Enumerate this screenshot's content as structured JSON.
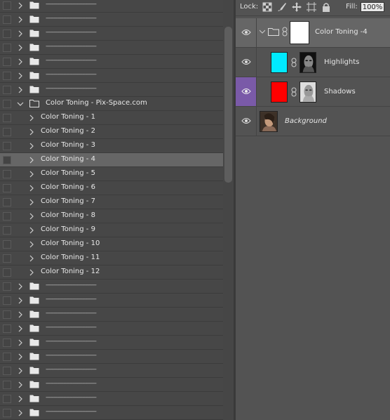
{
  "actions_panel": {
    "separator_text": "--------------------------------",
    "top_collapsed_count": 7,
    "group": {
      "label": "Color Toning - Pix-Space.com",
      "items": [
        "Color Toning - 1",
        "Color Toning - 2",
        "Color Toning - 3",
        "Color Toning - 4",
        "Color Toning - 5",
        "Color Toning - 6",
        "Color Toning - 7",
        "Color Toning - 8",
        "Color Toning - 9",
        "Color Toning - 10",
        "Color Toning - 11",
        "Color Toning - 12"
      ],
      "selected_index": 3
    },
    "bottom_collapsed_count": 10
  },
  "layers_panel": {
    "lock_label": "Lock:",
    "fill_label": "Fill:",
    "fill_value": "100%",
    "layers": [
      {
        "name": "Color Toning -4",
        "kind": "group",
        "italic": false
      },
      {
        "name": "Highlights",
        "kind": "adjustment",
        "swatch": "#00eaff",
        "italic": false
      },
      {
        "name": "Shadows",
        "kind": "adjustment",
        "swatch": "#ff0000",
        "italic": false
      },
      {
        "name": "Background",
        "kind": "image",
        "italic": true
      }
    ]
  },
  "colors": {
    "highlights_swatch": "#00eaff",
    "shadows_swatch": "#ff0000",
    "selected_eye_bg": "#7a5aa8",
    "selected_action_bg": "#666666"
  },
  "icons": [
    "checkbox-icon",
    "chevron-right-icon",
    "chevron-down-icon",
    "folder-icon",
    "eye-icon",
    "lock-transparent-icon",
    "lock-paint-icon",
    "lock-move-icon",
    "lock-artboard-icon",
    "lock-all-icon",
    "link-icon"
  ]
}
